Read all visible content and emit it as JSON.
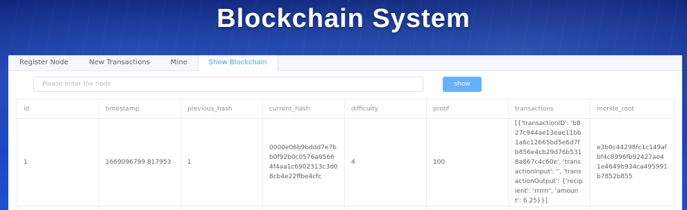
{
  "header": {
    "title": "Blockchain System"
  },
  "tabs": [
    {
      "label": "Register Node",
      "active": false
    },
    {
      "label": "New Transactions",
      "active": false
    },
    {
      "label": "Mine",
      "active": false
    },
    {
      "label": "Show Blockchain",
      "active": true
    }
  ],
  "node_search": {
    "placeholder": "Please enter the node",
    "value": ""
  },
  "show_button": {
    "label": "show"
  },
  "table": {
    "columns": [
      "id",
      "timestamp",
      "previous_hash",
      "current_hash",
      "difficulty",
      "proof",
      "transactions",
      "merkle_root"
    ],
    "rows": [
      {
        "id": "1",
        "timestamp": "1669096799.817953",
        "previous_hash": "1",
        "current_hash": "0000e06b9bddd7e7bb0f92b0c0576a05664f4aa1c6902313c3d08cb4e22ffbe4cfc",
        "difficulty": "4",
        "proof": "100",
        "transactions": "[{'transactionID': 'b827c944ae13eae11bb1a6c12665bd5e6d7fb856e4cb29d76b5318a867c4c60e', 'transactionInput': '', 'transactionOutput': {'recipient': 'rrrrrr', 'amount': 6.25}}]",
        "merkle_root": "e3b0c44298fc1c149afbf4c8996fb92427ae41e4649b934ca495991b7852b855"
      }
    ]
  },
  "colors": {
    "accent": "#409eff",
    "button": "#66b1ff",
    "banner": "#1437a8"
  }
}
